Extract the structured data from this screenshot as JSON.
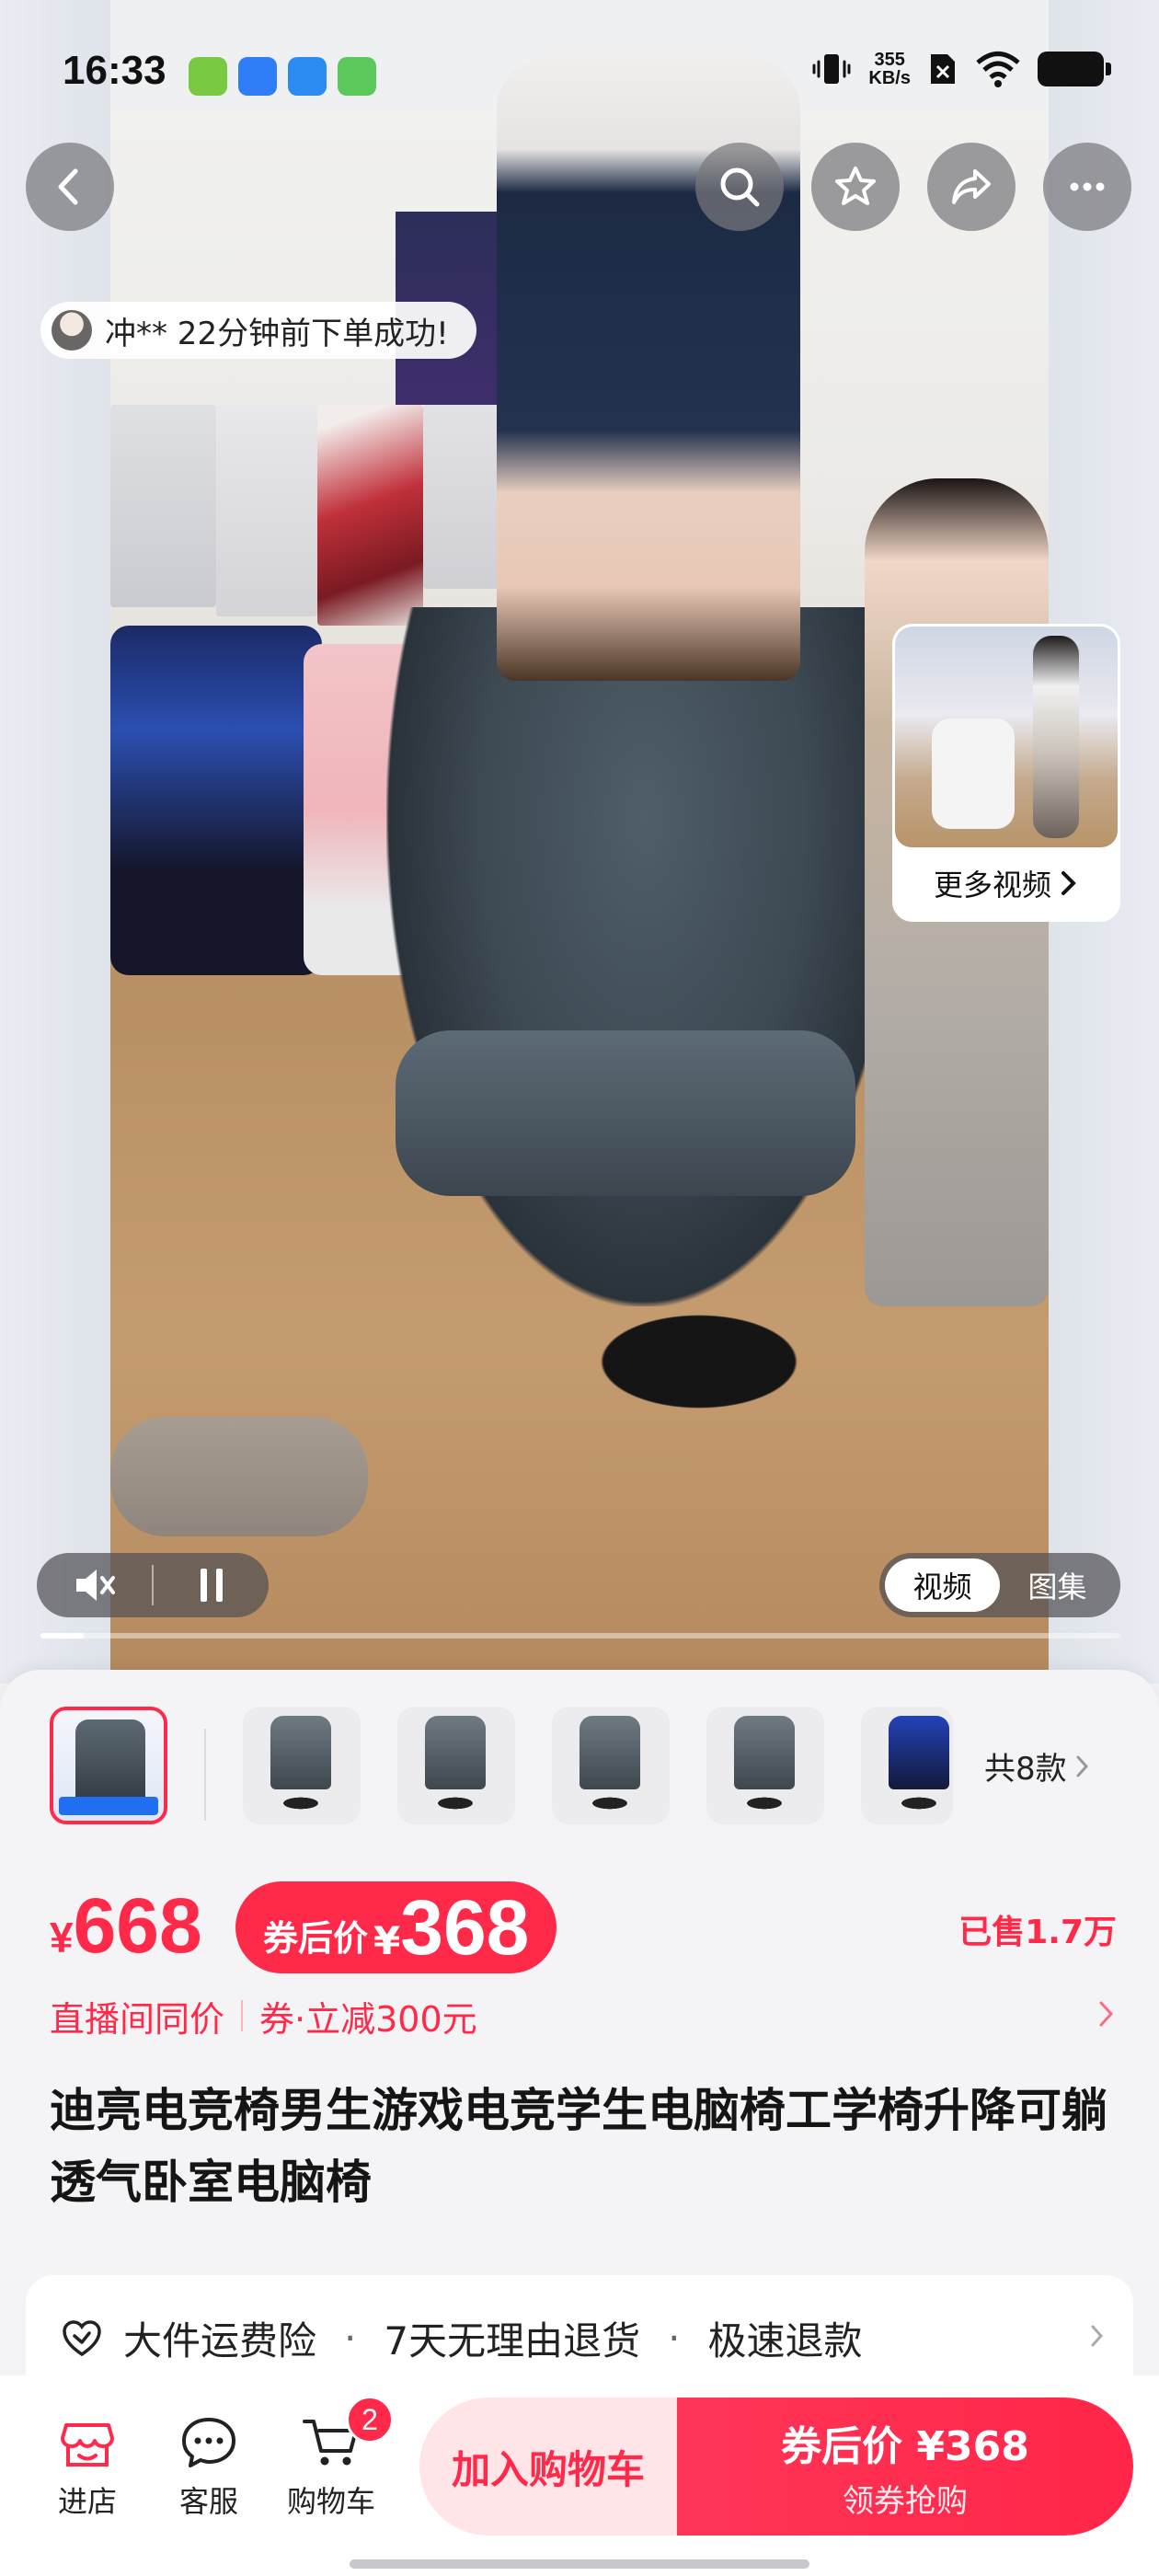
{
  "status_bar": {
    "time": "16:33",
    "net_speed_value": "355",
    "net_speed_unit": "KB/s",
    "app_icon_colors": [
      "#7ac943",
      "#2f7df6",
      "#2b8bf0",
      "#5ac85a"
    ]
  },
  "top_nav": {
    "back_icon": "chevron-left-icon",
    "search_icon": "search-icon",
    "favorite_icon": "star-icon",
    "share_icon": "share-icon",
    "more_icon": "more-dots-icon"
  },
  "order_toast": {
    "text": "冲** 22分钟前下单成功!"
  },
  "more_videos": {
    "label": "更多视频"
  },
  "video_controls": {
    "mute_icon": "mute-icon",
    "pause_icon": "pause-icon",
    "tabs": [
      "视频",
      "图集"
    ],
    "active_tab": "视频",
    "progress": 0.04
  },
  "variants": {
    "count_label": "共8款"
  },
  "price": {
    "currency": "¥",
    "original": "668",
    "coupon_label": "券后价",
    "coupon_price": "368",
    "sold": "已售1.7万"
  },
  "promo": {
    "live_same_price": "直播间同价",
    "coupon_discount": "券·立减300元"
  },
  "product": {
    "title": "迪亮电竞椅男生游戏电竞学生电脑椅工学椅升降可躺透气卧室电脑椅"
  },
  "services": {
    "items": [
      "大件运费险",
      "7天无理由退货",
      "极速退款"
    ]
  },
  "bottom_bar": {
    "shop_label": "进店",
    "service_label": "客服",
    "cart_label": "购物车",
    "cart_badge": "2",
    "add_to_cart": "加入购物车",
    "buy_line1": "券后价 ¥368",
    "buy_line2": "领券抢购"
  },
  "colors": {
    "accent_red": "#ff2a4a",
    "cart_button_bg": "#ffe4e8"
  }
}
